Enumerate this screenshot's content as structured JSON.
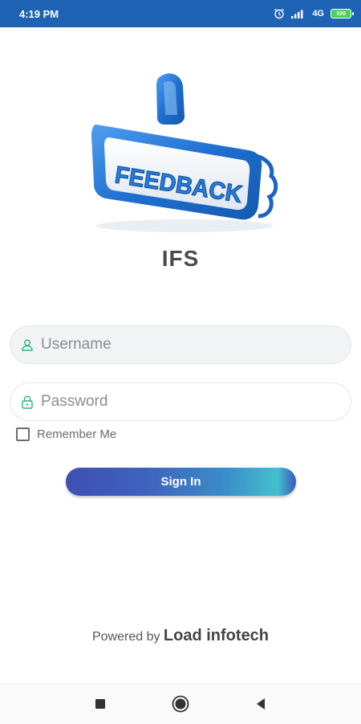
{
  "status_bar": {
    "time": "4:19 PM",
    "network": "4G",
    "battery_level": "100",
    "icons": [
      "alarm-icon",
      "signal-icon",
      "network-type-icon",
      "battery-icon"
    ]
  },
  "logo": {
    "text": "FEEDBACK",
    "icon": "thumbs-up-icon",
    "colors": {
      "primary": "#1e6fd0",
      "highlight": "#6fb5f2"
    }
  },
  "app": {
    "name": "IFS"
  },
  "form": {
    "username": {
      "placeholder": "Username",
      "value": "",
      "icon": "user-icon"
    },
    "password": {
      "placeholder": "Password",
      "value": "",
      "icon": "lock-icon"
    },
    "remember_me": {
      "label": "Remember Me",
      "checked": false
    },
    "submit_label": "Sign In"
  },
  "footer": {
    "prefix": "Powered by",
    "company": "Load infotech"
  },
  "nav_bar": {
    "buttons": [
      "recent-apps-icon",
      "home-icon",
      "back-icon"
    ]
  },
  "colors": {
    "status_bar": "#1e63b4",
    "accent_icon": "#2bb77a",
    "button_gradient_start": "#3f4fb2",
    "button_gradient_end": "#44c0cf"
  }
}
